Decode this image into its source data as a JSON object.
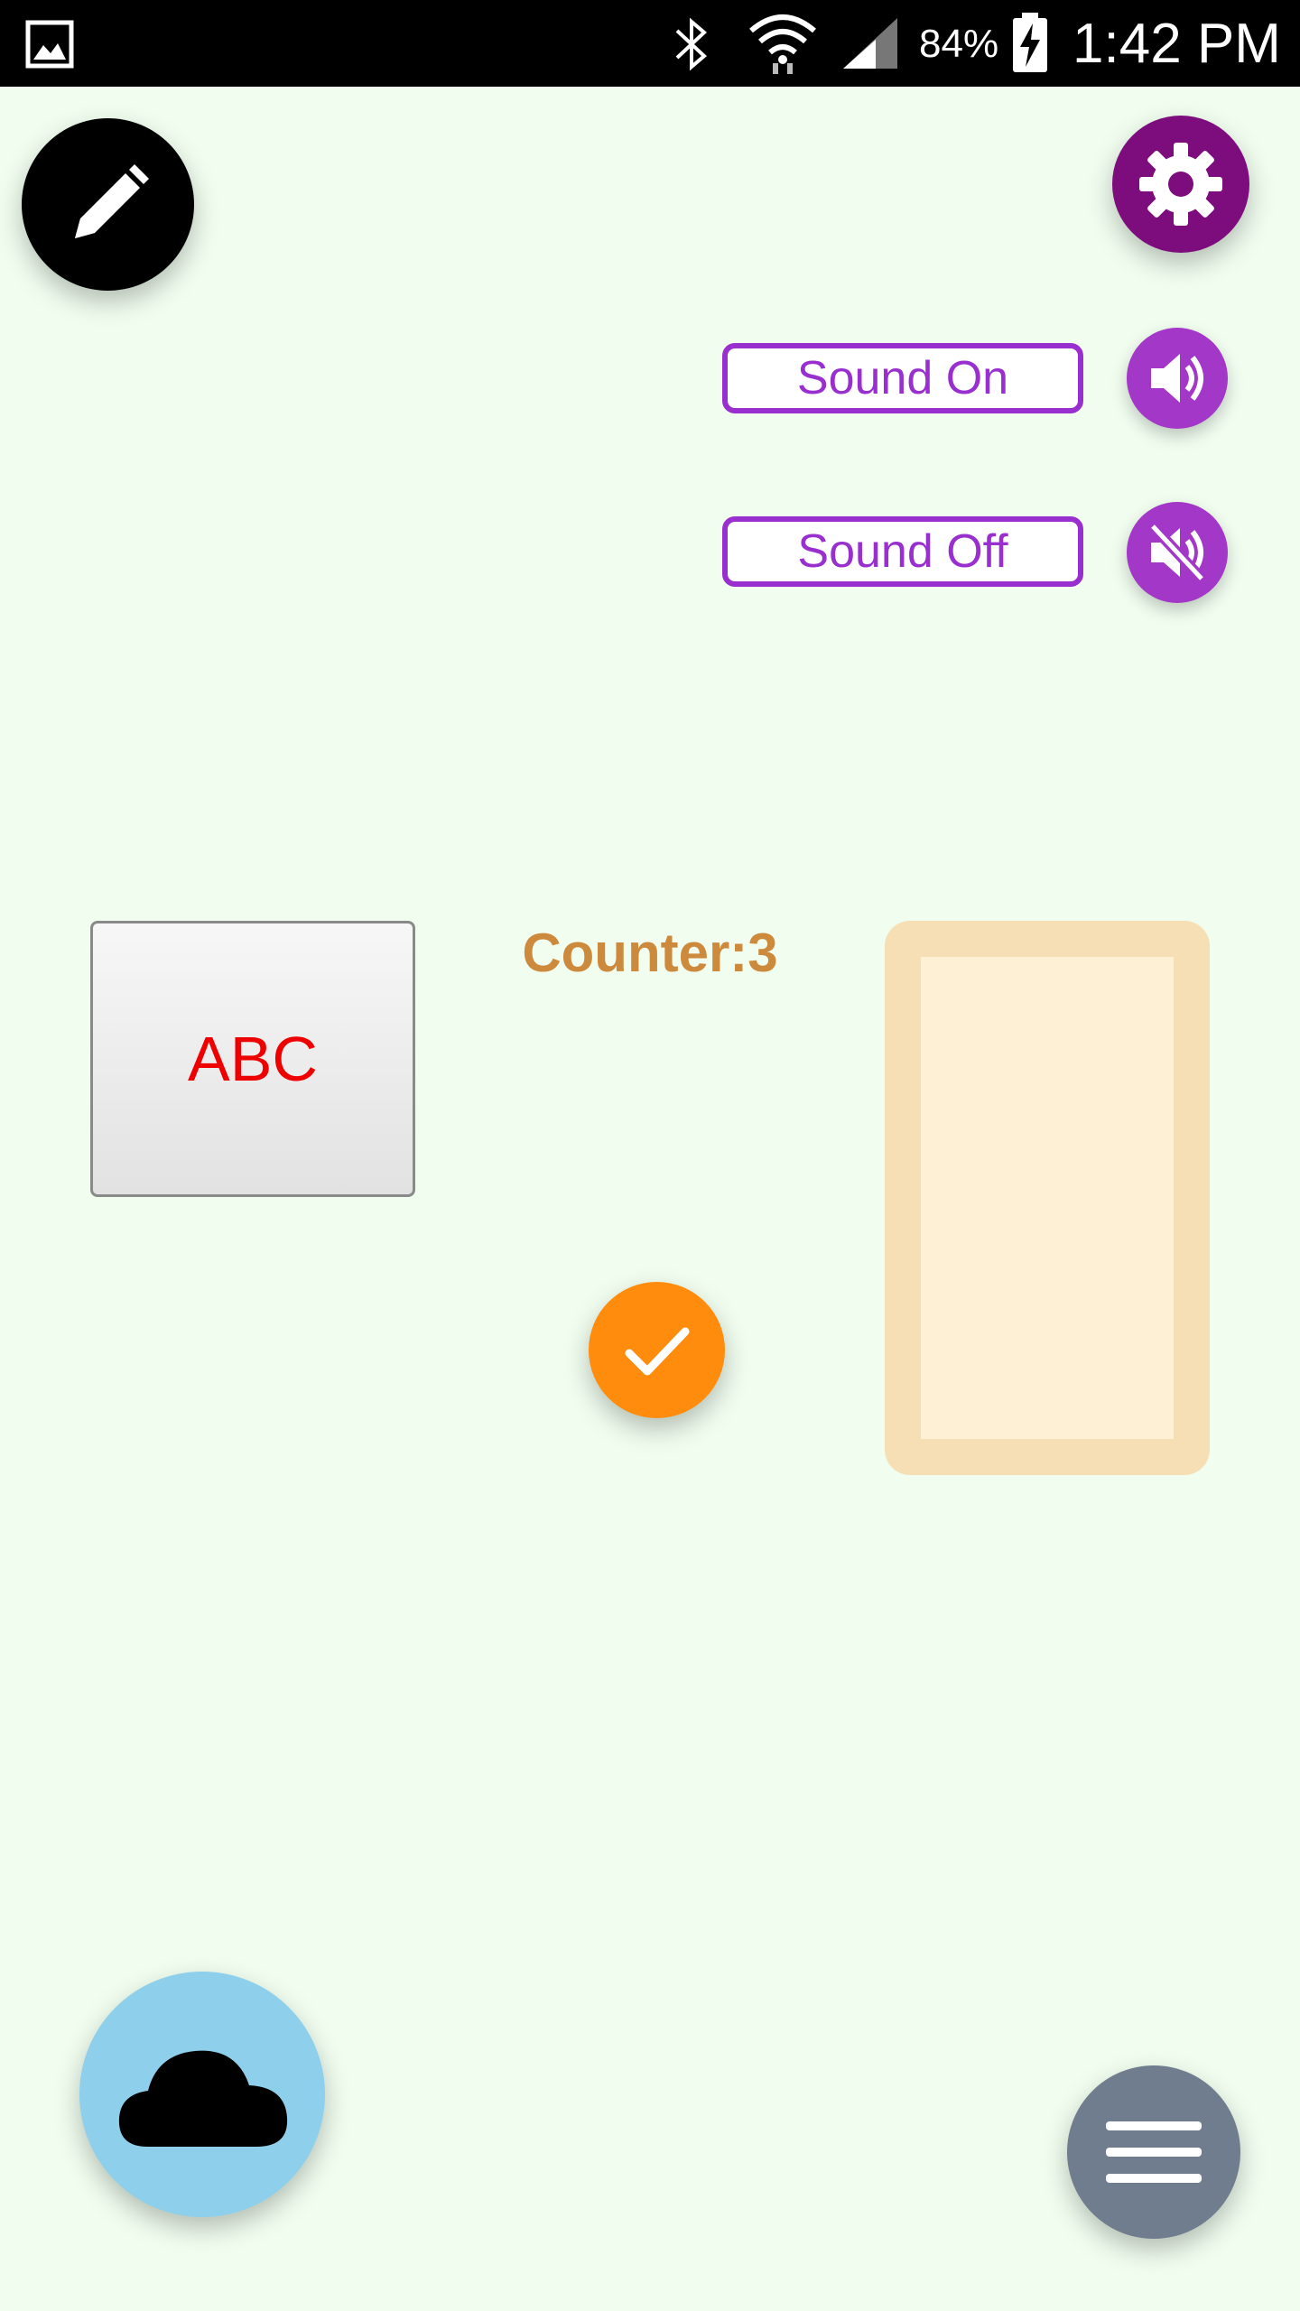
{
  "status_bar": {
    "battery_text": "84%",
    "time": "1:42 PM",
    "icons": [
      "gallery-icon",
      "bluetooth-icon",
      "wifi-icon",
      "signal-icon",
      "battery-charging-icon"
    ]
  },
  "buttons": {
    "sound_on_label": "Sound On",
    "sound_off_label": "Sound Off",
    "abc_label": "ABC"
  },
  "counter": {
    "text": "Counter:3"
  },
  "icons": {
    "edit": "pencil-icon",
    "settings": "gear-icon",
    "sound_on": "volume-on-icon",
    "sound_off": "volume-off-icon",
    "confirm": "checkmark-icon",
    "cloud": "cloud-icon",
    "menu": "hamburger-menu-icon"
  },
  "colors": {
    "background": "#f0fdef",
    "accent_purple": "#9a2fd0",
    "settings_purple": "#7d0d7d",
    "check_orange": "#ff8c0d",
    "cloud_blue": "#8ed0ec",
    "menu_slate": "#6f7d8e",
    "counter_text": "#cd8a3c",
    "abc_text": "#ee0000",
    "frame_border": "#f6dfb5",
    "frame_fill": "#fef0d5"
  }
}
